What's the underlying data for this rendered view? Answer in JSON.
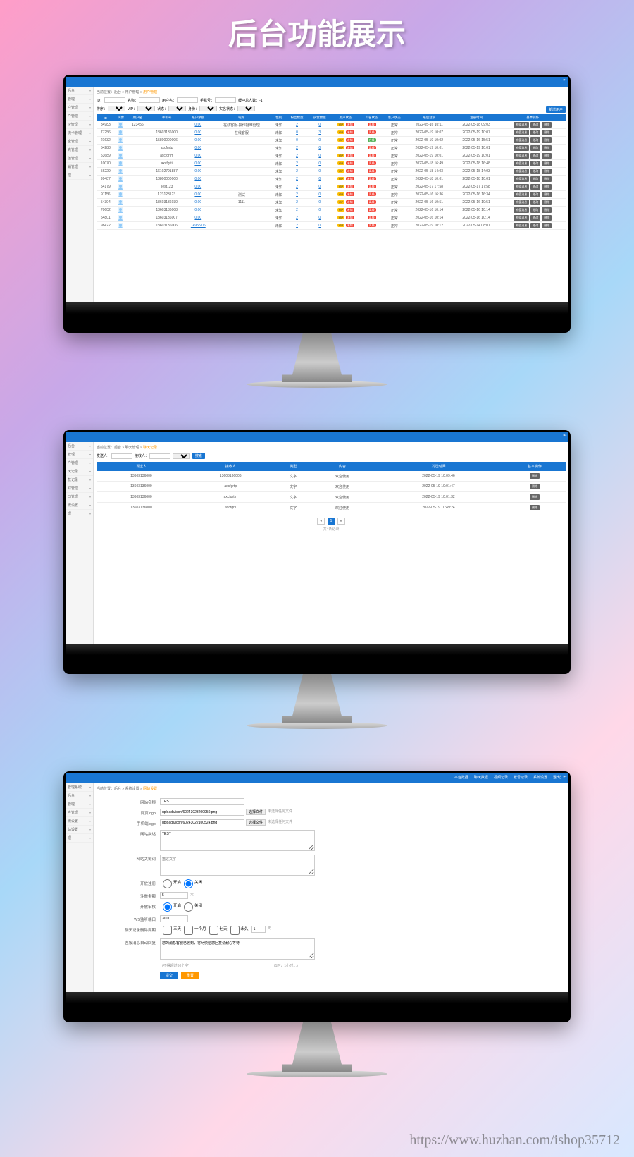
{
  "page_title": "后台功能展示",
  "watermark": "https://www.huzhan.com/ishop35712",
  "screen1": {
    "crumb_label": "当前位置：",
    "crumb_home": "后台",
    "crumb_p1": "用户管理",
    "crumb_p2": "用户管理",
    "nav": [
      "后台",
      "管理",
      "户管理",
      "户管理",
      "IP管理",
      "流卡管理",
      "全管理",
      "充管理",
      "值管理",
      "销管理",
      "理"
    ],
    "filters": {
      "id_label": "ID：",
      "name_label": "名称：",
      "user_label": "用户名：",
      "phone_label": "手机号：",
      "total_label": "缓冲总人数：-1",
      "sort_label": "排序：",
      "vip_label": "VIP：",
      "status_label": "状态：",
      "role_label": "身份：",
      "realname_label": "实名状态：",
      "opt_none": "不限"
    },
    "newbtn": "新增用户",
    "headers": [
      "ID",
      "头像",
      "用户名",
      "手机号",
      "账户余额",
      "昵称",
      "性别",
      "粉丝数量",
      "获赞数量",
      "用户状态",
      "实名状态",
      "客户状态",
      "最后登录",
      "注册时间",
      "基本操作"
    ],
    "rows": [
      {
        "id": "84983",
        "user": "123456",
        "phone": "",
        "bal": "0.00",
        "nick": "在线客服·操作疑难处理",
        "sex": "未知",
        "fans": "2",
        "likes": "0",
        "vip": "VIP",
        "real": "未知",
        "cust": "离线",
        "login": "2022-05-16 10:11",
        "reg": "2022-05-18 09:03"
      },
      {
        "id": "77256",
        "user": "",
        "phone": "13603136000",
        "bal": "0.00",
        "nick": "在线客服",
        "sex": "未知",
        "fans": "0",
        "likes": "3",
        "vip": "VIP",
        "real": "未知",
        "cust": "离线",
        "login": "2022-05-19 10:07",
        "reg": "2022-05-19 10:07"
      },
      {
        "id": "21632",
        "user": "",
        "phone": "15800000006",
        "bal": "0.00",
        "nick": "",
        "sex": "未知",
        "fans": "0",
        "likes": "0",
        "vip": "VIP",
        "real": "未知",
        "cust": "在线",
        "login": "2022-05-19 10:02",
        "reg": "2022-05-16 15:51",
        "green": true
      },
      {
        "id": "54288",
        "user": "",
        "phone": "axcfgrtp",
        "bal": "0.00",
        "nick": "",
        "sex": "未知",
        "fans": "2",
        "likes": "0",
        "vip": "VIP",
        "real": "未知",
        "cust": "离线",
        "login": "2022-05-19 10:01",
        "reg": "2022-05-19 10:01"
      },
      {
        "id": "53689",
        "user": "",
        "phone": "axcfgrtm",
        "bal": "0.00",
        "nick": "",
        "sex": "未知",
        "fans": "2",
        "likes": "0",
        "vip": "VIP",
        "real": "未知",
        "cust": "离线",
        "login": "2022-05-19 10:01",
        "reg": "2022-05-19 10:01"
      },
      {
        "id": "10070",
        "user": "",
        "phone": "axcfgrti",
        "bal": "0.00",
        "nick": "",
        "sex": "未知",
        "fans": "2",
        "likes": "0",
        "vip": "VIP",
        "real": "未知",
        "cust": "离线",
        "login": "2022-05-18 16:49",
        "reg": "2022-05-18 16:48"
      },
      {
        "id": "56229",
        "user": "",
        "phone": "16102791887",
        "bal": "0.00",
        "nick": "",
        "sex": "未知",
        "fans": "2",
        "likes": "0",
        "vip": "VIP",
        "real": "未知",
        "cust": "离线",
        "login": "2022-05-18 14:03",
        "reg": "2022-05-18 14:03"
      },
      {
        "id": "99487",
        "user": "",
        "phone": "13800000000",
        "bal": "0.00",
        "nick": "",
        "sex": "未知",
        "fans": "2",
        "likes": "0",
        "vip": "VIP",
        "real": "未知",
        "cust": "离线",
        "login": "2022-05-18 10:01",
        "reg": "2022-05-18 10:01"
      },
      {
        "id": "54179",
        "user": "",
        "phone": "Test123",
        "bal": "0.00",
        "nick": "",
        "sex": "未知",
        "fans": "2",
        "likes": "0",
        "vip": "VIP",
        "real": "未知",
        "cust": "离线",
        "login": "2022-05-17 17:58",
        "reg": "2022-05-17 17:58"
      },
      {
        "id": "91156",
        "user": "",
        "phone": "123123123",
        "bal": "0.00",
        "nick": "测试",
        "sex": "未知",
        "fans": "2",
        "likes": "0",
        "vip": "VIP",
        "real": "未知",
        "cust": "离线",
        "login": "2022-05-16 16:36",
        "reg": "2022-05-16 16:34"
      },
      {
        "id": "54394",
        "user": "",
        "phone": "13603136030",
        "bal": "0.00",
        "nick": "1111",
        "sex": "未知",
        "fans": "2",
        "likes": "0",
        "vip": "VIP",
        "real": "未知",
        "cust": "离线",
        "login": "2022-05-16 10:51",
        "reg": "2022-05-16 10:51"
      },
      {
        "id": "70602",
        "user": "",
        "phone": "13603136008",
        "bal": "0.00",
        "nick": "",
        "sex": "未知",
        "fans": "2",
        "likes": "0",
        "vip": "VIP",
        "real": "未知",
        "cust": "离线",
        "login": "2022-05-16 10:14",
        "reg": "2022-05-16 10:14"
      },
      {
        "id": "54801",
        "user": "",
        "phone": "13603136007",
        "bal": "0.00",
        "nick": "",
        "sex": "未知",
        "fans": "2",
        "likes": "0",
        "vip": "VIP",
        "real": "未知",
        "cust": "离线",
        "login": "2022-05-16 10:14",
        "reg": "2022-05-16 10:14"
      },
      {
        "id": "98422",
        "user": "",
        "phone": "13603136006",
        "bal": "14955.06",
        "nick": "",
        "sex": "未知",
        "fans": "2",
        "likes": "0",
        "vip": "VIP",
        "real": "未知",
        "cust": "离线",
        "login": "2022-05-19 10:12",
        "reg": "2022-05-14 08:01"
      }
    ],
    "act_detail": "充值消息",
    "act_edit": "修改",
    "act_del": "删除"
  },
  "screen2": {
    "crumb_label": "当前位置：",
    "crumb_home": "后台",
    "crumb_p1": "聊天管理",
    "crumb_p2": "聊天记录",
    "nav": [
      "后台",
      "管理",
      "户管理",
      "天记录",
      "款记录",
      "财管理",
      "口管理",
      "统设置",
      "理"
    ],
    "filters": {
      "sender_label": "发送人：",
      "receiver_label": "接收人：",
      "opt_none": "不限",
      "search": "搜索"
    },
    "headers": [
      "发送人",
      "接收人",
      "类型",
      "内容",
      "发送时间",
      "基本操作"
    ],
    "rows": [
      {
        "s": "13603136000",
        "r": "13603136006",
        "t": "文字",
        "c": "欢迎使用",
        "d": "2022-05-19 10:09:46"
      },
      {
        "s": "13603136000",
        "r": "axcfgrtp",
        "t": "文字",
        "c": "欢迎使用",
        "d": "2022-05-19 10:01:47"
      },
      {
        "s": "13603136000",
        "r": "axcfgrtm",
        "t": "文字",
        "c": "欢迎使用",
        "d": "2022-05-19 10:01:32"
      },
      {
        "s": "13603136000",
        "r": "axcfgrti",
        "t": "文字",
        "c": "欢迎使用",
        "d": "2022-05-19 10:49:24"
      }
    ],
    "act_del": "删除",
    "pager": {
      "prev": "«",
      "p1": "1",
      "next": "»",
      "total": "共4条记录"
    }
  },
  "screen3": {
    "topnav": [
      "平台数据",
      "聊天数据",
      "视频记录",
      "帐号记录",
      "系统设置",
      "退出登录"
    ],
    "crumb_label": "当前位置：",
    "crumb_home": "后台",
    "crumb_p1": "系统设置",
    "crumb_p2": "网站设置",
    "nav": [
      "管理系统",
      "后台",
      "管理",
      "户管理",
      "统设置",
      "站设置",
      "理"
    ],
    "form": {
      "sitename_label": "网站名称",
      "sitename_val": "TEST",
      "logo_label": "网页logo",
      "logo_val": "uploads/icon/60243023200950.png",
      "choose_btn": "选择文件",
      "nofile": "未选择任何文件",
      "mlogo_label": "手机端logo",
      "mlogo_val": "uploads/icon/60243022100524.png",
      "desc_label": "网站描述",
      "desc_val": "TEST",
      "keyword_ph": "描述文字",
      "keyword_label": "网站关键词",
      "regstatus_label": "开放注册",
      "open": "开启",
      "close": "关闭",
      "regamount_label": "注册金额",
      "regamount_val": "5",
      "unit": "元",
      "audit_label": "开放审核",
      "port_label": "WS监听端口",
      "port_val": "3011",
      "chatperiod_label": "聊天记录删除周期",
      "d3": "三天",
      "d7": "一个月",
      "d30": "七天",
      "dn": "永久",
      "custom": "天",
      "welcome_label": "客服消息自动回复",
      "welcome_val": "您的消息客服已收到，将尽快给您回复请耐心等待",
      "siglimit": "(不得超过60个字)",
      "lastnote": "(1时，1小时…)",
      "submit": "提交",
      "reset": "重置"
    }
  }
}
